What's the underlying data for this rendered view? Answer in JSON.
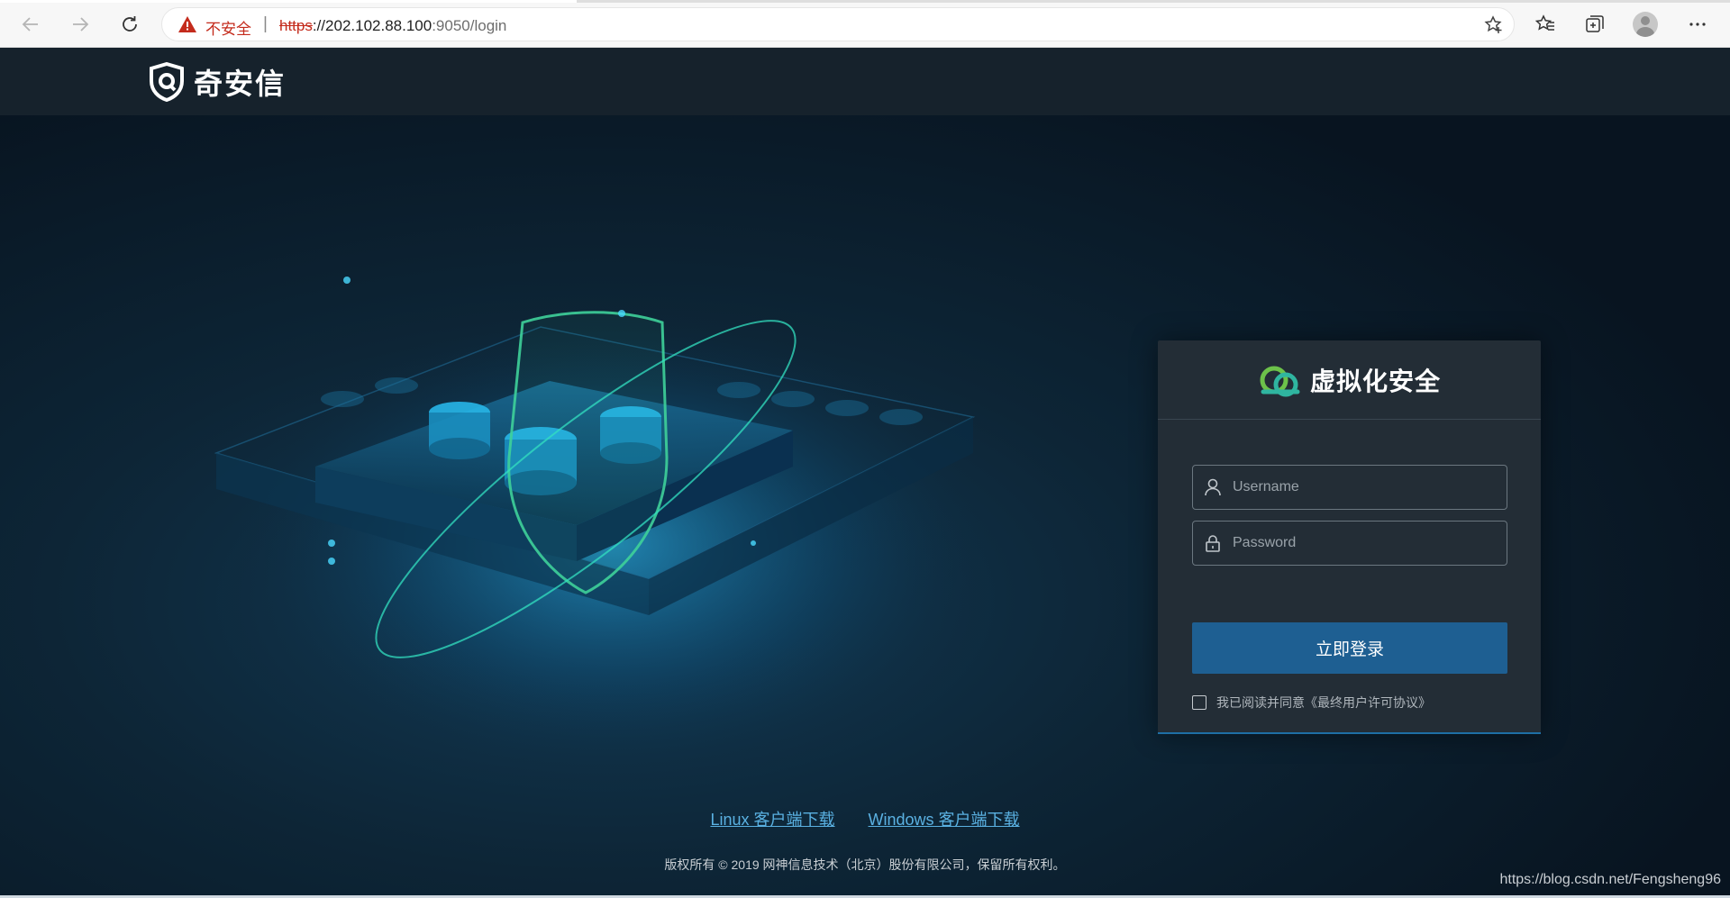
{
  "browser": {
    "security_label": "不安全",
    "separator": "|",
    "url_scheme": "https",
    "url_host": "://202.102.88.100",
    "url_port_path": ":9050/login",
    "icons": [
      "back-icon",
      "forward-icon",
      "refresh-icon",
      "warning-icon",
      "favorite-add-icon",
      "favorites-icon",
      "collections-icon",
      "profile-avatar",
      "more-icon"
    ]
  },
  "header": {
    "brand": "奇安信"
  },
  "login": {
    "product_name": "虚拟化安全",
    "username_placeholder": "Username",
    "password_placeholder": "Password",
    "submit_label": "立即登录",
    "agreement_text": "我已阅读并同意《最终用户许可协议》",
    "agreement_checked": false
  },
  "downloads": {
    "linux_label": "Linux 客户端下载",
    "windows_label": "Windows 客户端下载"
  },
  "footer": {
    "copyright": "版权所有 © 2019 网神信息技术（北京）股份有限公司，保留所有权利。",
    "watermark": "https://blog.csdn.net/Fengsheng96"
  },
  "colors": {
    "accent": "#1e5f92",
    "link": "#5ab1e2",
    "card_bg": "#232d36",
    "insecure": "#c42b1c"
  }
}
